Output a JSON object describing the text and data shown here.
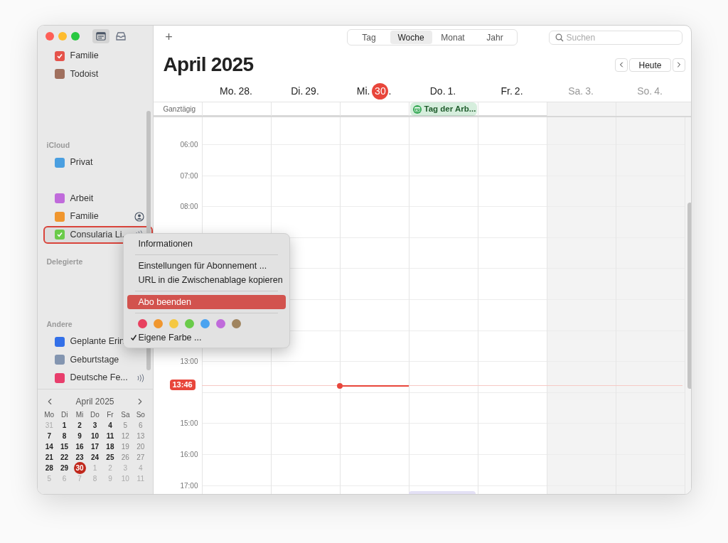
{
  "sidebar": {
    "toolbar": [
      {
        "kind": "calendar",
        "selected": true
      },
      {
        "kind": "inbox",
        "selected": false
      }
    ],
    "groups": [
      {
        "items": [
          {
            "name": "Familie",
            "color": "#e5534b",
            "checked": true,
            "selected": false,
            "kind": "plain"
          },
          {
            "name": "Todoist",
            "color": "#a0705e",
            "checked": false,
            "selected": false,
            "kind": "plain"
          }
        ]
      },
      {
        "title": "iCloud",
        "items": [
          {
            "name": "Privat",
            "color": "#4a9fe0",
            "checked": false,
            "selected": false,
            "kind": "plain"
          },
          {
            "name": "Arbeit",
            "color": "#c06bdb",
            "checked": false,
            "selected": false,
            "kind": "plain"
          },
          {
            "name": "Familie",
            "color": "#f0962e",
            "checked": false,
            "selected": false,
            "kind": "shared"
          },
          {
            "name": "Consularia Li.",
            "color": "#6acb4a",
            "checked": true,
            "selected": true,
            "kind": "subscribed"
          }
        ]
      },
      {
        "title": "Delegierte"
      },
      {
        "title": "Andere",
        "items": [
          {
            "name": "Geplante Erin",
            "color": "#3370e8",
            "checked": false,
            "selected": false,
            "kind": "plain"
          },
          {
            "name": "Geburtstage",
            "color": "#8395b0",
            "checked": false,
            "selected": false,
            "kind": "plain"
          },
          {
            "name": "Deutsche Fe...",
            "color": "#e83e6c",
            "checked": false,
            "selected": false,
            "kind": "subscribed"
          }
        ]
      }
    ],
    "mini_calendar": {
      "title": "April 2025",
      "weekdays": [
        "Mo",
        "Di",
        "Mi",
        "Do",
        "Fr",
        "Sa",
        "So"
      ],
      "weeks": [
        [
          {
            "day": "31",
            "in_month": false,
            "today": false
          },
          {
            "day": "1",
            "in_month": true,
            "today": false
          },
          {
            "day": "2",
            "in_month": true,
            "today": false
          },
          {
            "day": "3",
            "in_month": true,
            "today": false
          },
          {
            "day": "4",
            "in_month": true,
            "today": false
          },
          {
            "day": "5",
            "in_month": true,
            "today": false
          },
          {
            "day": "6",
            "in_month": true,
            "today": false
          }
        ],
        [
          {
            "day": "7",
            "in_month": true,
            "today": false
          },
          {
            "day": "8",
            "in_month": true,
            "today": false
          },
          {
            "day": "9",
            "in_month": true,
            "today": false
          },
          {
            "day": "10",
            "in_month": true,
            "today": false
          },
          {
            "day": "11",
            "in_month": true,
            "today": false
          },
          {
            "day": "12",
            "in_month": true,
            "today": false
          },
          {
            "day": "13",
            "in_month": true,
            "today": false
          }
        ],
        [
          {
            "day": "14",
            "in_month": true,
            "today": false
          },
          {
            "day": "15",
            "in_month": true,
            "today": false
          },
          {
            "day": "16",
            "in_month": true,
            "today": false
          },
          {
            "day": "17",
            "in_month": true,
            "today": false
          },
          {
            "day": "18",
            "in_month": true,
            "today": false
          },
          {
            "day": "19",
            "in_month": true,
            "today": false
          },
          {
            "day": "20",
            "in_month": true,
            "today": false
          }
        ],
        [
          {
            "day": "21",
            "in_month": true,
            "today": false
          },
          {
            "day": "22",
            "in_month": true,
            "today": false
          },
          {
            "day": "23",
            "in_month": true,
            "today": false
          },
          {
            "day": "24",
            "in_month": true,
            "today": false
          },
          {
            "day": "25",
            "in_month": true,
            "today": false
          },
          {
            "day": "26",
            "in_month": true,
            "today": false
          },
          {
            "day": "27",
            "in_month": true,
            "today": false
          }
        ],
        [
          {
            "day": "28",
            "in_month": true,
            "today": false
          },
          {
            "day": "29",
            "in_month": true,
            "today": false
          },
          {
            "day": "30",
            "in_month": true,
            "today": true
          },
          {
            "day": "1",
            "in_month": false,
            "today": false
          },
          {
            "day": "2",
            "in_month": false,
            "today": false
          },
          {
            "day": "3",
            "in_month": false,
            "today": false
          },
          {
            "day": "4",
            "in_month": false,
            "today": false
          }
        ],
        [
          {
            "day": "5",
            "in_month": false,
            "today": false
          },
          {
            "day": "6",
            "in_month": false,
            "today": false
          },
          {
            "day": "7",
            "in_month": false,
            "today": false
          },
          {
            "day": "8",
            "in_month": false,
            "today": false
          },
          {
            "day": "9",
            "in_month": false,
            "today": false
          },
          {
            "day": "10",
            "in_month": false,
            "today": false
          },
          {
            "day": "11",
            "in_month": false,
            "today": false
          }
        ]
      ]
    }
  },
  "toolbar": {
    "add": "+",
    "views": [
      {
        "label": "Tag",
        "selected": false
      },
      {
        "label": "Woche",
        "selected": true
      },
      {
        "label": "Monat",
        "selected": false
      },
      {
        "label": "Jahr",
        "selected": false
      }
    ],
    "search": {
      "placeholder": "Suchen"
    }
  },
  "title": "April 2025",
  "today_button": "Heute",
  "days": [
    {
      "weekday": "Mo.",
      "number": "28",
      "suffix": ".",
      "today": false,
      "weekend": false
    },
    {
      "weekday": "Di.",
      "number": "29",
      "suffix": ".",
      "today": false,
      "weekend": false
    },
    {
      "weekday": "Mi.",
      "number": "30",
      "suffix": ".",
      "today": true,
      "weekend": false
    },
    {
      "weekday": "Do.",
      "number": "1",
      "suffix": ".",
      "today": false,
      "weekend": false,
      "all_day_events": [
        {
          "title": "Tag der Arb...",
          "color": "#34a853"
        }
      ]
    },
    {
      "weekday": "Fr.",
      "number": "2",
      "suffix": ".",
      "today": false,
      "weekend": false
    },
    {
      "weekday": "Sa.",
      "number": "3",
      "suffix": ".",
      "today": false,
      "weekend": true
    },
    {
      "weekday": "So.",
      "number": "4",
      "suffix": ".",
      "today": false,
      "weekend": true
    }
  ],
  "all_day_label": "Ganztägig",
  "hour_lines": [
    {
      "kind": "labeled",
      "label": "06:00"
    },
    {
      "kind": "labeled",
      "label": "07:00"
    },
    {
      "kind": "labeled",
      "label": "08:00"
    },
    {
      "kind": "plain"
    },
    {
      "kind": "plain"
    },
    {
      "kind": "plain"
    },
    {
      "kind": "plain"
    },
    {
      "kind": "labeled",
      "label": "13:00"
    },
    {
      "kind": "plain"
    },
    {
      "kind": "labeled",
      "label": "15:00"
    },
    {
      "kind": "labeled",
      "label": "16:00"
    },
    {
      "kind": "labeled",
      "label": "17:00"
    }
  ],
  "now": "13:46",
  "context_menu": [
    {
      "kind": "item",
      "label": "Informationen",
      "selected": false
    },
    {
      "kind": "separator"
    },
    {
      "kind": "item",
      "label": "Einstellungen für Abonnement ...",
      "selected": false
    },
    {
      "kind": "item",
      "label": "URL in die Zwischenablage kopieren",
      "selected": false
    },
    {
      "kind": "separator"
    },
    {
      "kind": "item",
      "label": "Abo beenden",
      "selected": true
    },
    {
      "kind": "separator"
    },
    {
      "kind": "colors",
      "swatches": [
        {
          "color": "#e8405f"
        },
        {
          "color": "#f0962e"
        },
        {
          "color": "#f5c842"
        },
        {
          "color": "#6acb4a"
        },
        {
          "color": "#4aa3f0"
        },
        {
          "color": "#c06bdb"
        },
        {
          "color": "#a08560"
        }
      ]
    },
    {
      "kind": "check",
      "label": "Eigene Farbe ...",
      "checked": true
    }
  ]
}
